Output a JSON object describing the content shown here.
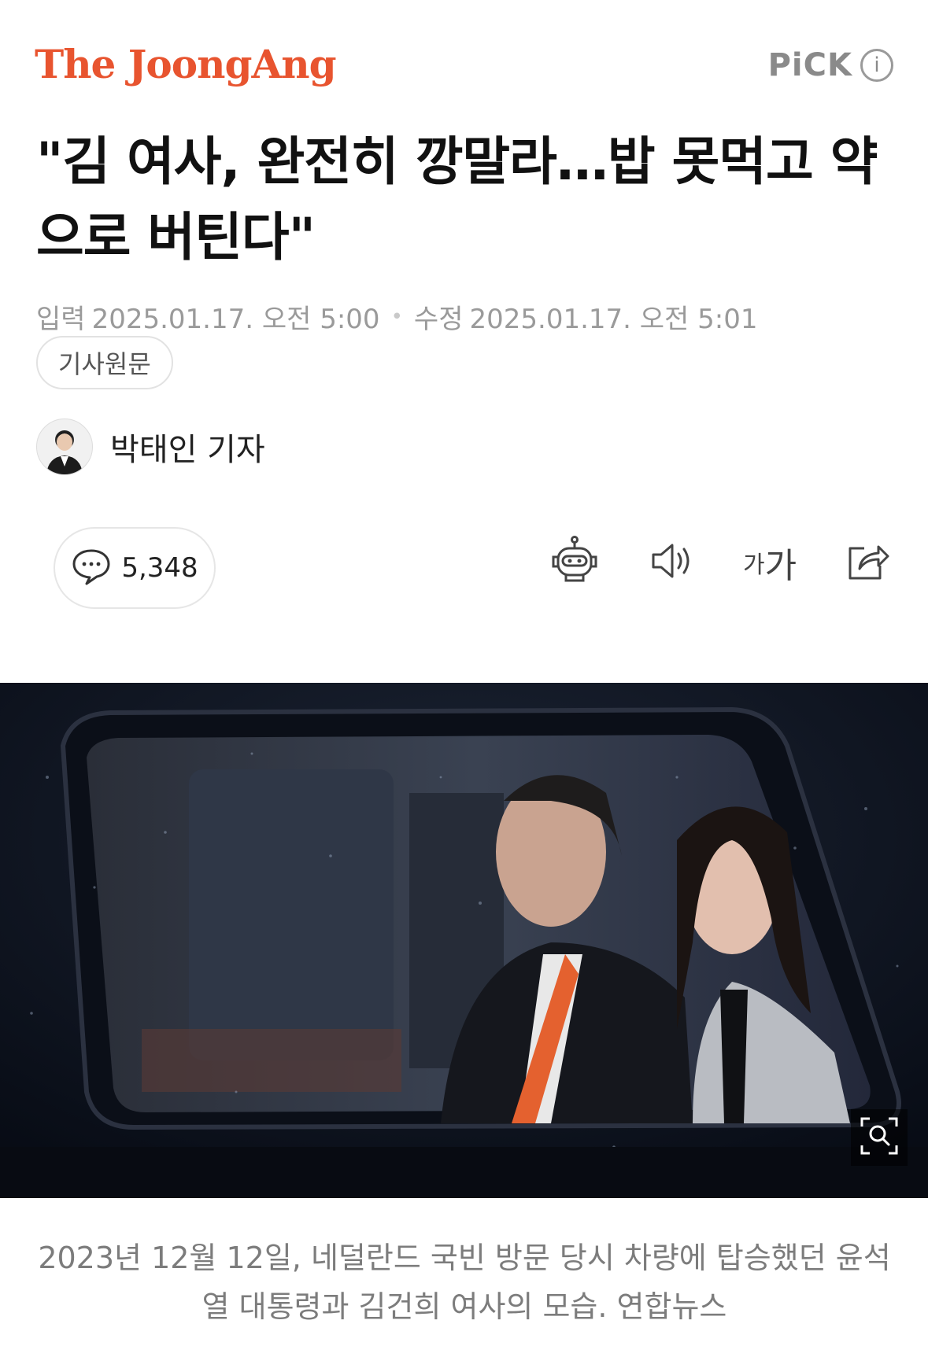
{
  "header": {
    "logo_text": "The JoongAng",
    "pick_label": "PiCK",
    "pick_info_glyph": "i"
  },
  "article": {
    "headline": "\"김 여사, 완전히 깡말라…밥 못먹고 약으로 버틴다\"",
    "published_label": "입력",
    "published_at": "2025.01.17. 오전 5:00",
    "modified_label": "수정",
    "modified_at": "2025.01.17. 오전 5:01",
    "original_button": "기사원문",
    "reporter": "박태인 기자"
  },
  "actions": {
    "comment_count": "5,348",
    "font_small": "가",
    "font_large": "가"
  },
  "photo": {
    "caption": "2023년 12월 12일, 네덜란드 국빈 방문 당시 차량에 탑승했던 윤석열 대통령과 김건희 여사의 모습. 연합뉴스"
  },
  "colors": {
    "brand": "#e8542f",
    "muted_text": "#9a9a9a"
  }
}
